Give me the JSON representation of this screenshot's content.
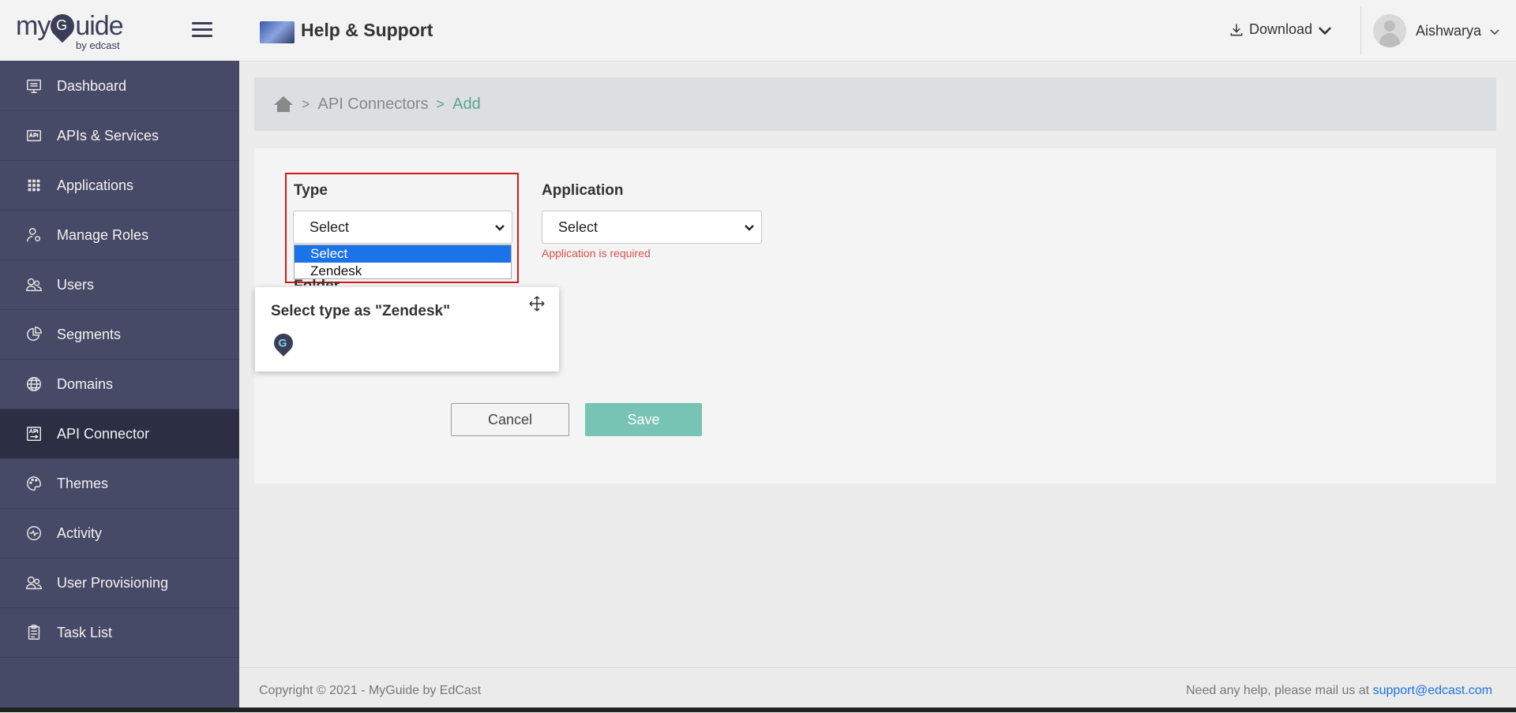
{
  "app": {
    "logo_text": "myGuide",
    "logo_sub": "by edcast"
  },
  "header": {
    "title": "Help & Support",
    "download_label": "Download",
    "user_name": "Aishwarya"
  },
  "sidebar": {
    "items": [
      {
        "label": "Dashboard",
        "icon": "monitor-icon"
      },
      {
        "label": "APIs & Services",
        "icon": "api-icon"
      },
      {
        "label": "Applications",
        "icon": "grid-icon"
      },
      {
        "label": "Manage Roles",
        "icon": "user-gear-icon"
      },
      {
        "label": "Users",
        "icon": "users-icon"
      },
      {
        "label": "Segments",
        "icon": "pie-chart-icon"
      },
      {
        "label": "Domains",
        "icon": "globe-icon"
      },
      {
        "label": "API Connector",
        "icon": "api-connector-icon",
        "active": true
      },
      {
        "label": "Themes",
        "icon": "palette-icon"
      },
      {
        "label": "Activity",
        "icon": "activity-icon"
      },
      {
        "label": "User Provisioning",
        "icon": "users-icon"
      },
      {
        "label": "Task List",
        "icon": "clipboard-icon"
      }
    ]
  },
  "breadcrumb": {
    "items": [
      "API Connectors",
      "Add"
    ]
  },
  "form": {
    "type_label": "Type",
    "type_value": "Select",
    "type_options": [
      "Select",
      "Zendesk"
    ],
    "application_label": "Application",
    "application_value": "Select",
    "application_error": "Application is required",
    "folder_label": "Folder",
    "cancel_label": "Cancel",
    "save_label": "Save"
  },
  "tooltip": {
    "text": "Select type as \"Zendesk\""
  },
  "footer": {
    "copyright": "Copyright © 2021 - MyGuide by EdCast",
    "help_text": "Need any help, please mail us at ",
    "help_email": "support@edcast.com"
  },
  "colors": {
    "sidebar_bg": "#474a66",
    "sidebar_active": "#2c2e44",
    "accent_green": "#5aa58c",
    "save_button": "#77c4b4",
    "highlight_border": "#d21a1a",
    "error": "#d9534f",
    "link": "#1a73e8"
  }
}
